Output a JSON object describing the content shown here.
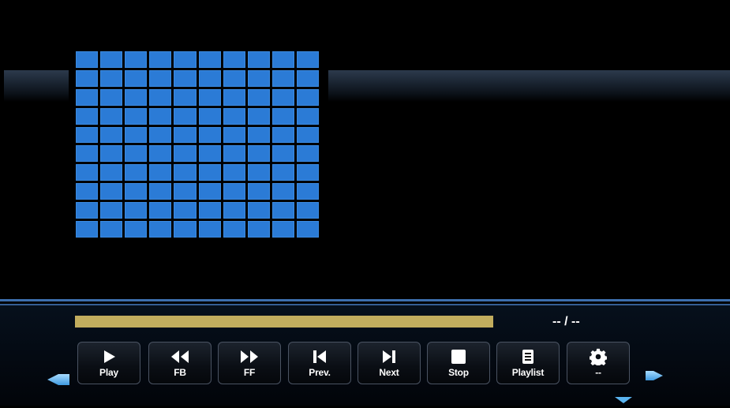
{
  "player": {
    "progress_fraction": 1.0,
    "time_text": "-- / --",
    "thumbnail_grid": {
      "rows": 10,
      "cols": 10
    }
  },
  "controls": {
    "play_label": "Play",
    "fb_label": "FB",
    "ff_label": "FF",
    "prev_label": "Prev.",
    "next_label": "Next",
    "stop_label": "Stop",
    "playlist_label": "Playlist",
    "settings_label": "--"
  },
  "icons": {
    "play": "play-icon",
    "fb": "fast-backward-icon",
    "ff": "fast-forward-icon",
    "prev": "skip-previous-icon",
    "next": "skip-next-icon",
    "stop": "stop-icon",
    "playlist": "playlist-icon",
    "settings": "gear-icon",
    "left": "arrow-left-icon",
    "right": "arrow-right-icon",
    "down": "arrow-down-icon"
  },
  "colors": {
    "tile": "#2b7bd6",
    "progress": "#b5a258",
    "accent": "#3d6fae",
    "arrow": "#5ab4f0"
  }
}
